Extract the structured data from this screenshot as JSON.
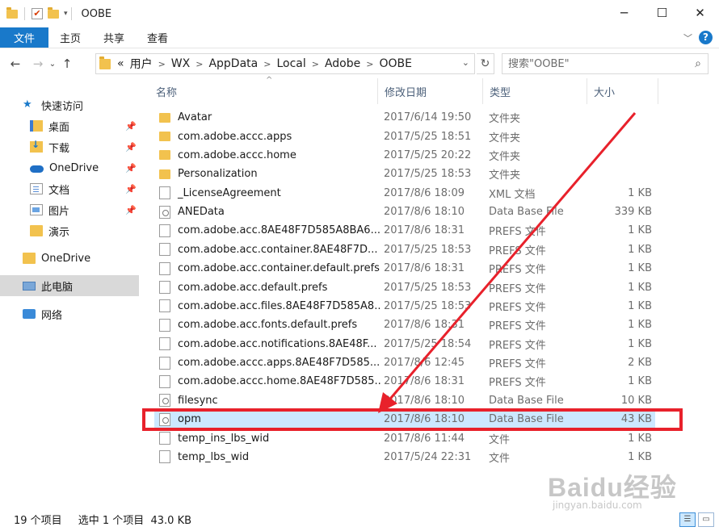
{
  "window": {
    "title": "OOBE",
    "controls": [
      "─",
      "☐",
      "✕"
    ]
  },
  "ribbon": {
    "tabs": [
      "文件",
      "主页",
      "共享",
      "查看"
    ],
    "help": "?"
  },
  "address": {
    "overflow": "«",
    "crumbs": [
      "用户",
      "WX",
      "AppData",
      "Local",
      "Adobe",
      "OOBE"
    ],
    "separator": ">"
  },
  "search": {
    "placeholder": "搜索\"OOBE\""
  },
  "sidebar": {
    "items": [
      {
        "label": "快速访问",
        "icon": "star-icon"
      },
      {
        "label": "桌面",
        "icon": "desktop-folder-icon",
        "pinned": true
      },
      {
        "label": "下载",
        "icon": "downloads-folder-icon",
        "pinned": true
      },
      {
        "label": "OneDrive",
        "icon": "onedrive-cloud-icon",
        "pinned": true
      },
      {
        "label": "文档",
        "icon": "documents-folder-icon",
        "pinned": true
      },
      {
        "label": "图片",
        "icon": "pictures-folder-icon",
        "pinned": true
      },
      {
        "label": "演示",
        "icon": "folder-icon",
        "pinned": false
      },
      {
        "label": "OneDrive",
        "icon": "folder-icon"
      },
      {
        "label": "此电脑",
        "icon": "this-pc-icon",
        "selected": true
      },
      {
        "label": "网络",
        "icon": "network-icon"
      }
    ]
  },
  "columns": {
    "name": "名称",
    "date": "修改日期",
    "type": "类型",
    "size": "大小"
  },
  "files": [
    {
      "name": "Avatar",
      "date": "2017/6/14 19:50",
      "type": "文件夹",
      "size": "",
      "kind": "folder"
    },
    {
      "name": "com.adobe.accc.apps",
      "date": "2017/5/25 18:51",
      "type": "文件夹",
      "size": "",
      "kind": "folder"
    },
    {
      "name": "com.adobe.accc.home",
      "date": "2017/5/25 20:22",
      "type": "文件夹",
      "size": "",
      "kind": "folder"
    },
    {
      "name": "Personalization",
      "date": "2017/5/25 18:53",
      "type": "文件夹",
      "size": "",
      "kind": "folder"
    },
    {
      "name": "_LicenseAgreement",
      "date": "2017/8/6 18:09",
      "type": "XML 文档",
      "size": "1 KB",
      "kind": "file"
    },
    {
      "name": "ANEData",
      "date": "2017/8/6 18:10",
      "type": "Data Base File",
      "size": "339 KB",
      "kind": "db"
    },
    {
      "name": "com.adobe.acc.8AE48F7D585A8BA6...",
      "date": "2017/8/6 18:31",
      "type": "PREFS 文件",
      "size": "1 KB",
      "kind": "file"
    },
    {
      "name": "com.adobe.acc.container.8AE48F7D...",
      "date": "2017/5/25 18:53",
      "type": "PREFS 文件",
      "size": "1 KB",
      "kind": "file"
    },
    {
      "name": "com.adobe.acc.container.default.prefs",
      "date": "2017/8/6 18:31",
      "type": "PREFS 文件",
      "size": "1 KB",
      "kind": "file"
    },
    {
      "name": "com.adobe.acc.default.prefs",
      "date": "2017/5/25 18:53",
      "type": "PREFS 文件",
      "size": "1 KB",
      "kind": "file"
    },
    {
      "name": "com.adobe.acc.files.8AE48F7D585A8...",
      "date": "2017/5/25 18:53",
      "type": "PREFS 文件",
      "size": "1 KB",
      "kind": "file"
    },
    {
      "name": "com.adobe.acc.fonts.default.prefs",
      "date": "2017/8/6 18:31",
      "type": "PREFS 文件",
      "size": "1 KB",
      "kind": "file"
    },
    {
      "name": "com.adobe.acc.notifications.8AE48F...",
      "date": "2017/5/25 18:54",
      "type": "PREFS 文件",
      "size": "1 KB",
      "kind": "file"
    },
    {
      "name": "com.adobe.accc.apps.8AE48F7D585...",
      "date": "2017/8/6 12:45",
      "type": "PREFS 文件",
      "size": "2 KB",
      "kind": "file"
    },
    {
      "name": "com.adobe.accc.home.8AE48F7D585...",
      "date": "2017/8/6 18:31",
      "type": "PREFS 文件",
      "size": "1 KB",
      "kind": "file"
    },
    {
      "name": "filesync",
      "date": "2017/8/6 18:10",
      "type": "Data Base File",
      "size": "10 KB",
      "kind": "db"
    },
    {
      "name": "opm",
      "date": "2017/8/6 18:10",
      "type": "Data Base File",
      "size": "43 KB",
      "kind": "db",
      "selected": true
    },
    {
      "name": "temp_ins_lbs_wid",
      "date": "2017/8/6 11:44",
      "type": "文件",
      "size": "1 KB",
      "kind": "file"
    },
    {
      "name": "temp_lbs_wid",
      "date": "2017/5/24 22:31",
      "type": "文件",
      "size": "1 KB",
      "kind": "file"
    }
  ],
  "status": {
    "count": "19 个项目",
    "selection": "选中 1 个项目  43.0 KB"
  },
  "watermark": {
    "logo": "Baidu经验",
    "url": "jingyan.baidu.com"
  },
  "annotation_colors": {
    "arrow": "#e8212b",
    "box": "#e8212b"
  }
}
